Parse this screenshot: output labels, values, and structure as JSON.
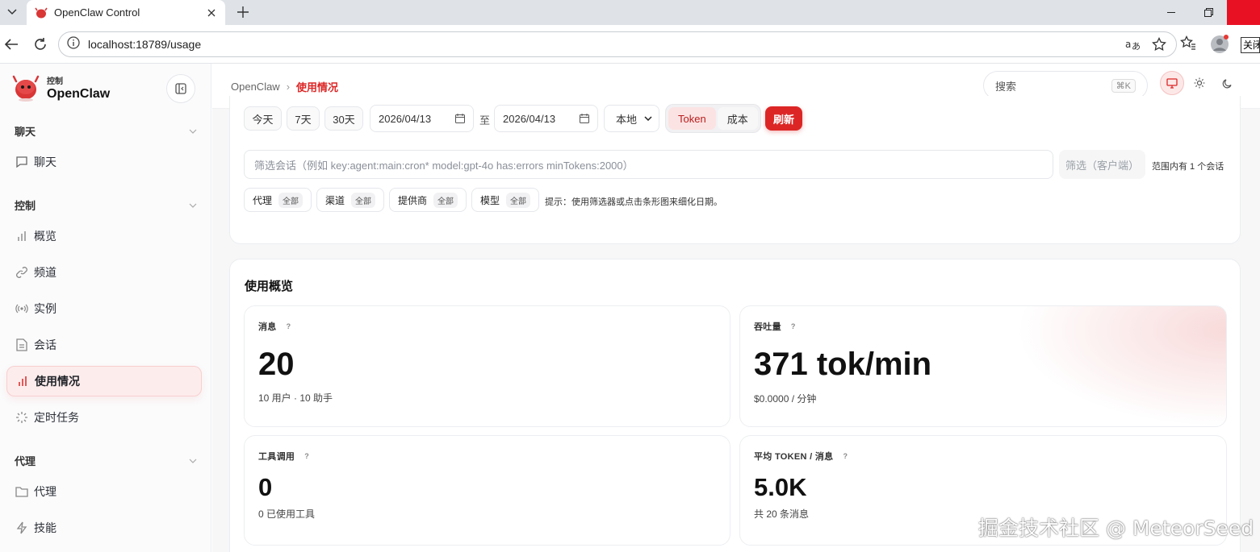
{
  "browser": {
    "tab_title": "OpenClaw Control",
    "url": "localhost:18789/usage",
    "ext_label": "关闭"
  },
  "sidebar": {
    "brand_sub": "控制",
    "brand_name": "OpenClaw",
    "groups": [
      {
        "label": "聊天",
        "items": [
          {
            "label": "聊天",
            "icon": "chat-bubble-icon"
          }
        ]
      },
      {
        "label": "控制",
        "items": [
          {
            "label": "概览",
            "icon": "bar-chart-icon"
          },
          {
            "label": "频道",
            "icon": "link-icon"
          },
          {
            "label": "实例",
            "icon": "broadcast-icon"
          },
          {
            "label": "会话",
            "icon": "document-icon"
          },
          {
            "label": "使用情况",
            "icon": "bar-chart-icon",
            "active": true
          },
          {
            "label": "定时任务",
            "icon": "spinner-icon"
          }
        ]
      },
      {
        "label": "代理",
        "items": [
          {
            "label": "代理",
            "icon": "folder-icon"
          },
          {
            "label": "技能",
            "icon": "lightning-icon"
          }
        ]
      }
    ]
  },
  "topbar": {
    "breadcrumb_root": "OpenClaw",
    "breadcrumb_current": "使用情况",
    "search_placeholder": "搜索",
    "search_shortcut": "⌘K"
  },
  "filters": {
    "quick_ranges": [
      "今天",
      "7天",
      "30天"
    ],
    "start_date": "2026/04/13",
    "to_label": "至",
    "end_date": "2026/04/13",
    "timezone": "本地",
    "mode_options": [
      "Token",
      "成本"
    ],
    "mode_selected": "Token",
    "refresh_label": "刷新",
    "session_filter_placeholder": "筛选会话（例如 key:agent:main:cron* model:gpt-4o has:errors minTokens:2000）",
    "client_filter_label": "筛选（客户端）",
    "range_info": "范围内有 1 个会话",
    "dimensions": [
      {
        "label": "代理",
        "value": "全部"
      },
      {
        "label": "渠道",
        "value": "全部"
      },
      {
        "label": "提供商",
        "value": "全部"
      },
      {
        "label": "模型",
        "value": "全部"
      }
    ],
    "hint": "提示：使用筛选器或点击条形图来细化日期。"
  },
  "overview": {
    "title": "使用概览",
    "stats": [
      {
        "label": "消息",
        "value": "20",
        "sub": "10 用户 · 10 助手"
      },
      {
        "label": "吞吐量",
        "value": "371 tok/min",
        "sub": "$0.0000 / 分钟"
      },
      {
        "label": "工具调用",
        "value": "0",
        "sub": "0 已使用工具"
      },
      {
        "label": "平均 TOKEN / 消息",
        "value": "5.0K",
        "sub": "共 20 条消息"
      }
    ]
  },
  "watermark": "掘金技术社区 @ MeteorSeed",
  "colors": {
    "accent": "#dc2626",
    "accent_soft": "#fdecec"
  }
}
